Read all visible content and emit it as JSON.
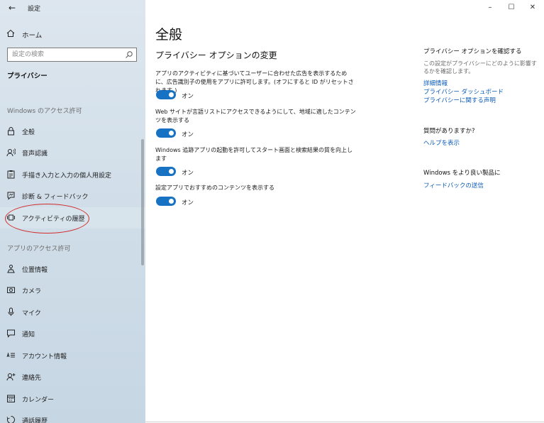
{
  "window": {
    "title": "設定",
    "controls": {
      "minimize": "–",
      "maximize": "☐",
      "close": "✕"
    }
  },
  "sidebar": {
    "back_symbol": "←",
    "home_label": "ホーム",
    "search_placeholder": "設定の検索",
    "section_heading": "プライバシー",
    "group_windows": "Windows のアクセス許可",
    "group_app": "アプリのアクセス許可",
    "items": [
      {
        "label": "全般",
        "icon": "lock-icon"
      },
      {
        "label": "音声認識",
        "icon": "speech-icon"
      },
      {
        "label": "手描き入力と入力の個人用設定",
        "icon": "clipboard-icon"
      },
      {
        "label": "診断 & フィードバック",
        "icon": "feedback-icon"
      },
      {
        "label": "アクティビティの履歴",
        "icon": "activity-icon"
      },
      {
        "label": "位置情報",
        "icon": "location-icon"
      },
      {
        "label": "カメラ",
        "icon": "camera-icon"
      },
      {
        "label": "マイク",
        "icon": "microphone-icon"
      },
      {
        "label": "通知",
        "icon": "notification-icon"
      },
      {
        "label": "アカウント情報",
        "icon": "account-info-icon"
      },
      {
        "label": "連絡先",
        "icon": "contacts-icon"
      },
      {
        "label": "カレンダー",
        "icon": "calendar-icon"
      },
      {
        "label": "通話履歴",
        "icon": "call-history-icon"
      }
    ]
  },
  "main": {
    "title": "全般",
    "sub_heading": "プライバシー オプションの変更",
    "settings": [
      {
        "description": "アプリのアクティビティに基づいてユーザーに合わせた広告を表示するために、広告識別子の使用をアプリに許可します。(オフにすると ID がリセットされます。)",
        "state": "オン"
      },
      {
        "description": "Web サイトが言語リストにアクセスできるようにして、地域に適したコンテンツを表示する",
        "state": "オン"
      },
      {
        "description": "Windows 追跡アプリの起動を許可してスタート画面と検索結果の質を向上します",
        "state": "オン"
      },
      {
        "description": "設定アプリでおすすめのコンテンツを表示する",
        "state": "オン"
      }
    ]
  },
  "right": {
    "heading1": "プライバシー オプションを確認する",
    "muted1": "この設定がプライバシーにどのように影響するかを確認します。",
    "links1": [
      "詳細情報",
      "プライバシー ダッシュボード",
      "プライバシーに関する声明"
    ],
    "heading2": "質問がありますか?",
    "link2": "ヘルプを表示",
    "heading3": "Windows をより良い製品に",
    "link3": "フィードバックの送信"
  },
  "colors": {
    "accent": "#1872c4",
    "link": "#0a5bb8",
    "annotation": "#d22b2b"
  }
}
